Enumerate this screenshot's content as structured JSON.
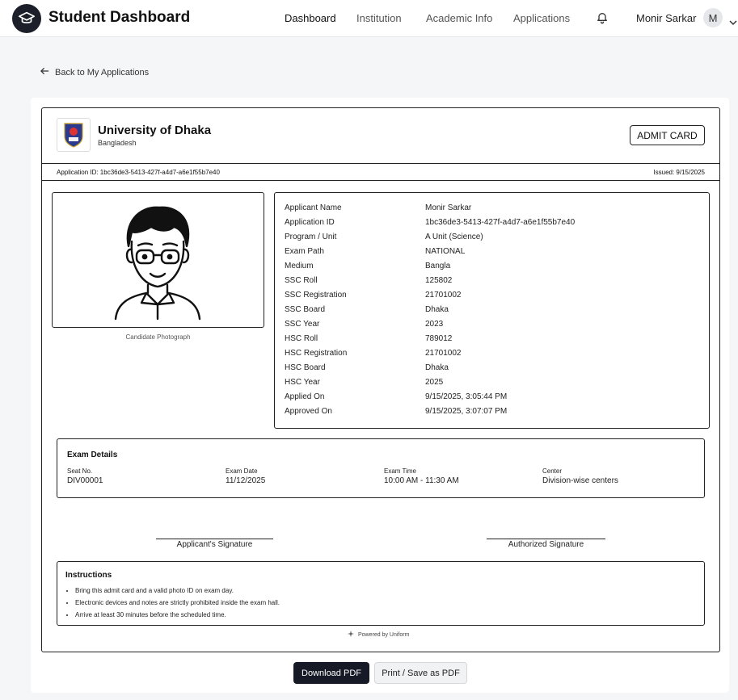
{
  "header": {
    "brand": "Student Dashboard",
    "nav": [
      {
        "label": "Dashboard",
        "active": true
      },
      {
        "label": "Institution",
        "active": false
      },
      {
        "label": "Academic Info",
        "active": false
      },
      {
        "label": "Applications",
        "active": false
      }
    ],
    "user_name": "Monir Sarkar",
    "avatar_initial": "M",
    "icons": {
      "logo": "graduation-cap-icon",
      "bell": "bell-icon",
      "chevron": "chevron-down-icon"
    }
  },
  "back_link": "Back to My Applications",
  "card": {
    "university": "University of Dhaka",
    "country": "Bangladesh",
    "badge": "ADMIT CARD",
    "application_id_line": "Application ID: 1bc36de3-5413-427f-a4d7-a6e1f55b7e40",
    "issued_line": "Issued: 9/15/2025",
    "photo_caption": "Candidate Photograph",
    "details": [
      {
        "label": "Applicant Name",
        "value": "Monir Sarkar"
      },
      {
        "label": "Application ID",
        "value": "1bc36de3-5413-427f-a4d7-a6e1f55b7e40"
      },
      {
        "label": "Program / Unit",
        "value": "A Unit (Science)"
      },
      {
        "label": "Exam Path",
        "value": "NATIONAL"
      },
      {
        "label": "Medium",
        "value": "Bangla"
      },
      {
        "label": "SSC Roll",
        "value": "125802"
      },
      {
        "label": "SSC Registration",
        "value": "21701002"
      },
      {
        "label": "SSC Board",
        "value": "Dhaka"
      },
      {
        "label": "SSC Year",
        "value": "2023"
      },
      {
        "label": "HSC Roll",
        "value": "789012"
      },
      {
        "label": "HSC Registration",
        "value": "21701002"
      },
      {
        "label": "HSC Board",
        "value": "Dhaka"
      },
      {
        "label": "HSC Year",
        "value": "2025"
      },
      {
        "label": "Applied On",
        "value": "9/15/2025, 3:05:44 PM"
      },
      {
        "label": "Approved On",
        "value": "9/15/2025, 3:07:07 PM"
      }
    ],
    "exam": {
      "title": "Exam Details",
      "fields": [
        {
          "label": "Seat No.",
          "value": "DIV00001"
        },
        {
          "label": "Exam Date",
          "value": "11/12/2025"
        },
        {
          "label": "Exam Time",
          "value": "10:00 AM - 11:30 AM"
        },
        {
          "label": "Center",
          "value": "Division-wise centers"
        }
      ]
    },
    "signatures": {
      "applicant": "Applicant's Signature",
      "authorized": "Authorized Signature"
    },
    "instructions": {
      "title": "Instructions",
      "items": [
        "Bring this admit card and a valid photo ID on exam day.",
        "Electronic devices and notes are strictly prohibited inside the exam hall.",
        "Arrive at least 30 minutes before the scheduled time."
      ]
    },
    "powered_by": "Powered by Uniform"
  },
  "actions": {
    "download": "Download PDF",
    "print": "Print / Save as PDF"
  }
}
